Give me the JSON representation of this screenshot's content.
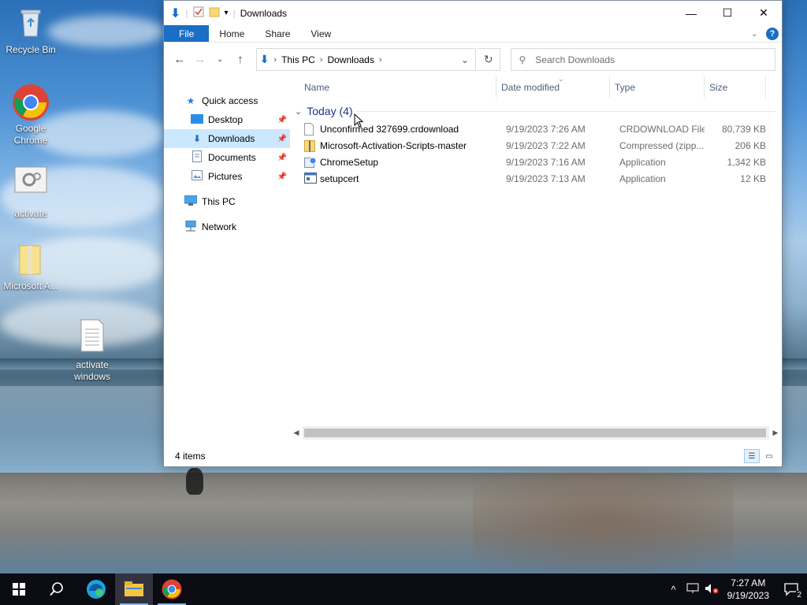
{
  "desktop": {
    "icons": [
      {
        "label": "Recycle Bin"
      },
      {
        "label": "Google Chrome"
      },
      {
        "label": "activate"
      },
      {
        "label": "Microsoft A..."
      },
      {
        "label": "activate windows"
      }
    ]
  },
  "window": {
    "title": "Downloads",
    "ribbon": {
      "file": "File",
      "home": "Home",
      "share": "Share",
      "view": "View"
    },
    "address": {
      "this_pc": "This PC",
      "downloads": "Downloads"
    },
    "search_placeholder": "Search Downloads",
    "nav": {
      "quick_access": "Quick access",
      "desktop": "Desktop",
      "downloads": "Downloads",
      "documents": "Documents",
      "pictures": "Pictures",
      "this_pc": "This PC",
      "network": "Network"
    },
    "columns": {
      "name": "Name",
      "date": "Date modified",
      "type": "Type",
      "size": "Size"
    },
    "group": "Today (4)",
    "files": [
      {
        "name": "Unconfirmed 327699.crdownload",
        "date": "9/19/2023 7:26 AM",
        "type": "CRDOWNLOAD File",
        "size": "80,739 KB",
        "icon": "blank-file-icon"
      },
      {
        "name": "Microsoft-Activation-Scripts-master",
        "date": "9/19/2023 7:22 AM",
        "type": "Compressed (zipp...",
        "size": "206 KB",
        "icon": "zip-folder-icon"
      },
      {
        "name": "ChromeSetup",
        "date": "9/19/2023 7:16 AM",
        "type": "Application",
        "size": "1,342 KB",
        "icon": "setup-app-icon"
      },
      {
        "name": "setupcert",
        "date": "9/19/2023 7:13 AM",
        "type": "Application",
        "size": "12 KB",
        "icon": "app-icon"
      }
    ],
    "status": "4 items"
  },
  "taskbar": {
    "clock_time": "7:27 AM",
    "clock_date": "9/19/2023",
    "notification_count": "2"
  }
}
